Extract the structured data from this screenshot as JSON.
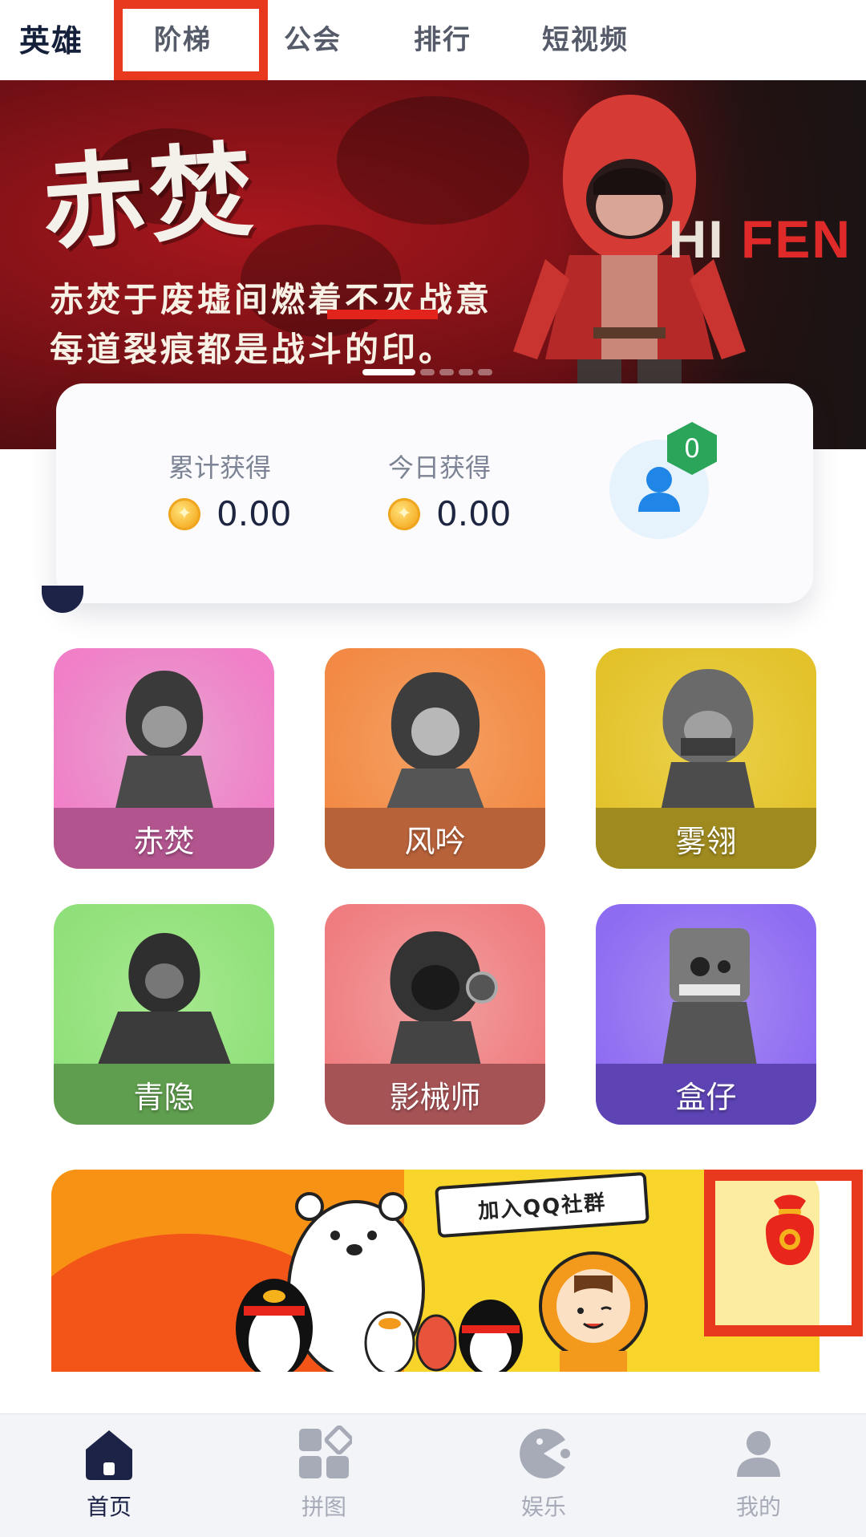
{
  "top_tabs": [
    {
      "label": "英雄",
      "active": true
    },
    {
      "label": "阶梯",
      "active": false
    },
    {
      "label": "公会",
      "active": false
    },
    {
      "label": "排行",
      "active": false
    },
    {
      "label": "短视频",
      "active": false
    }
  ],
  "banner": {
    "title": "赤焚",
    "brand_prefix": "HI",
    "brand_suffix": "FEN",
    "line1": "赤焚于废墟间燃着不灭战意",
    "line2": "每道裂痕都是战斗的印。",
    "indicator_count": 5,
    "indicator_active": 0
  },
  "stats": {
    "total_label": "累计获得",
    "total_value": "0.00",
    "today_label": "今日获得",
    "today_value": "0.00",
    "badge_count": "0",
    "coin_icon": "coin-icon",
    "avatar_icon": "user-avatar-icon"
  },
  "heroes": [
    {
      "name": "赤焚",
      "color_top": "#f07fc7",
      "color_bottom": "#e8a3d0",
      "strip": "#b2558f"
    },
    {
      "name": "风吟",
      "color_top": "#f28a45",
      "color_bottom": "#f5a163",
      "strip": "#b8623a"
    },
    {
      "name": "雾翎",
      "color_top": "#e2c12b",
      "color_bottom": "#ecd24b",
      "strip": "#9f8a1f"
    },
    {
      "name": "青隐",
      "color_top": "#8fe07a",
      "color_bottom": "#a7e98f",
      "strip": "#5f9e4e"
    },
    {
      "name": "影械师",
      "color_top": "#ef7d80",
      "color_bottom": "#f2a0a0",
      "strip": "#a65356"
    },
    {
      "name": "盒仔",
      "color_top": "#8e6cf2",
      "color_bottom": "#a98cf3",
      "strip": "#5d43b3"
    }
  ],
  "qq_banner": {
    "bubble_text": "加入QQ社群",
    "redbag_icon": "red-envelope-bag-icon"
  },
  "bottom_nav": [
    {
      "label": "首页",
      "icon": "home-icon",
      "active": true
    },
    {
      "label": "拼图",
      "icon": "puzzle-grid-icon",
      "active": false
    },
    {
      "label": "娱乐",
      "icon": "pacman-game-icon",
      "active": false
    },
    {
      "label": "我的",
      "icon": "profile-icon",
      "active": false
    }
  ],
  "colors": {
    "accent_dark": "#1c2347",
    "highlight_red": "#e8391f",
    "badge_green": "#2aa55a",
    "avatar_blue": "#1f86e8"
  }
}
